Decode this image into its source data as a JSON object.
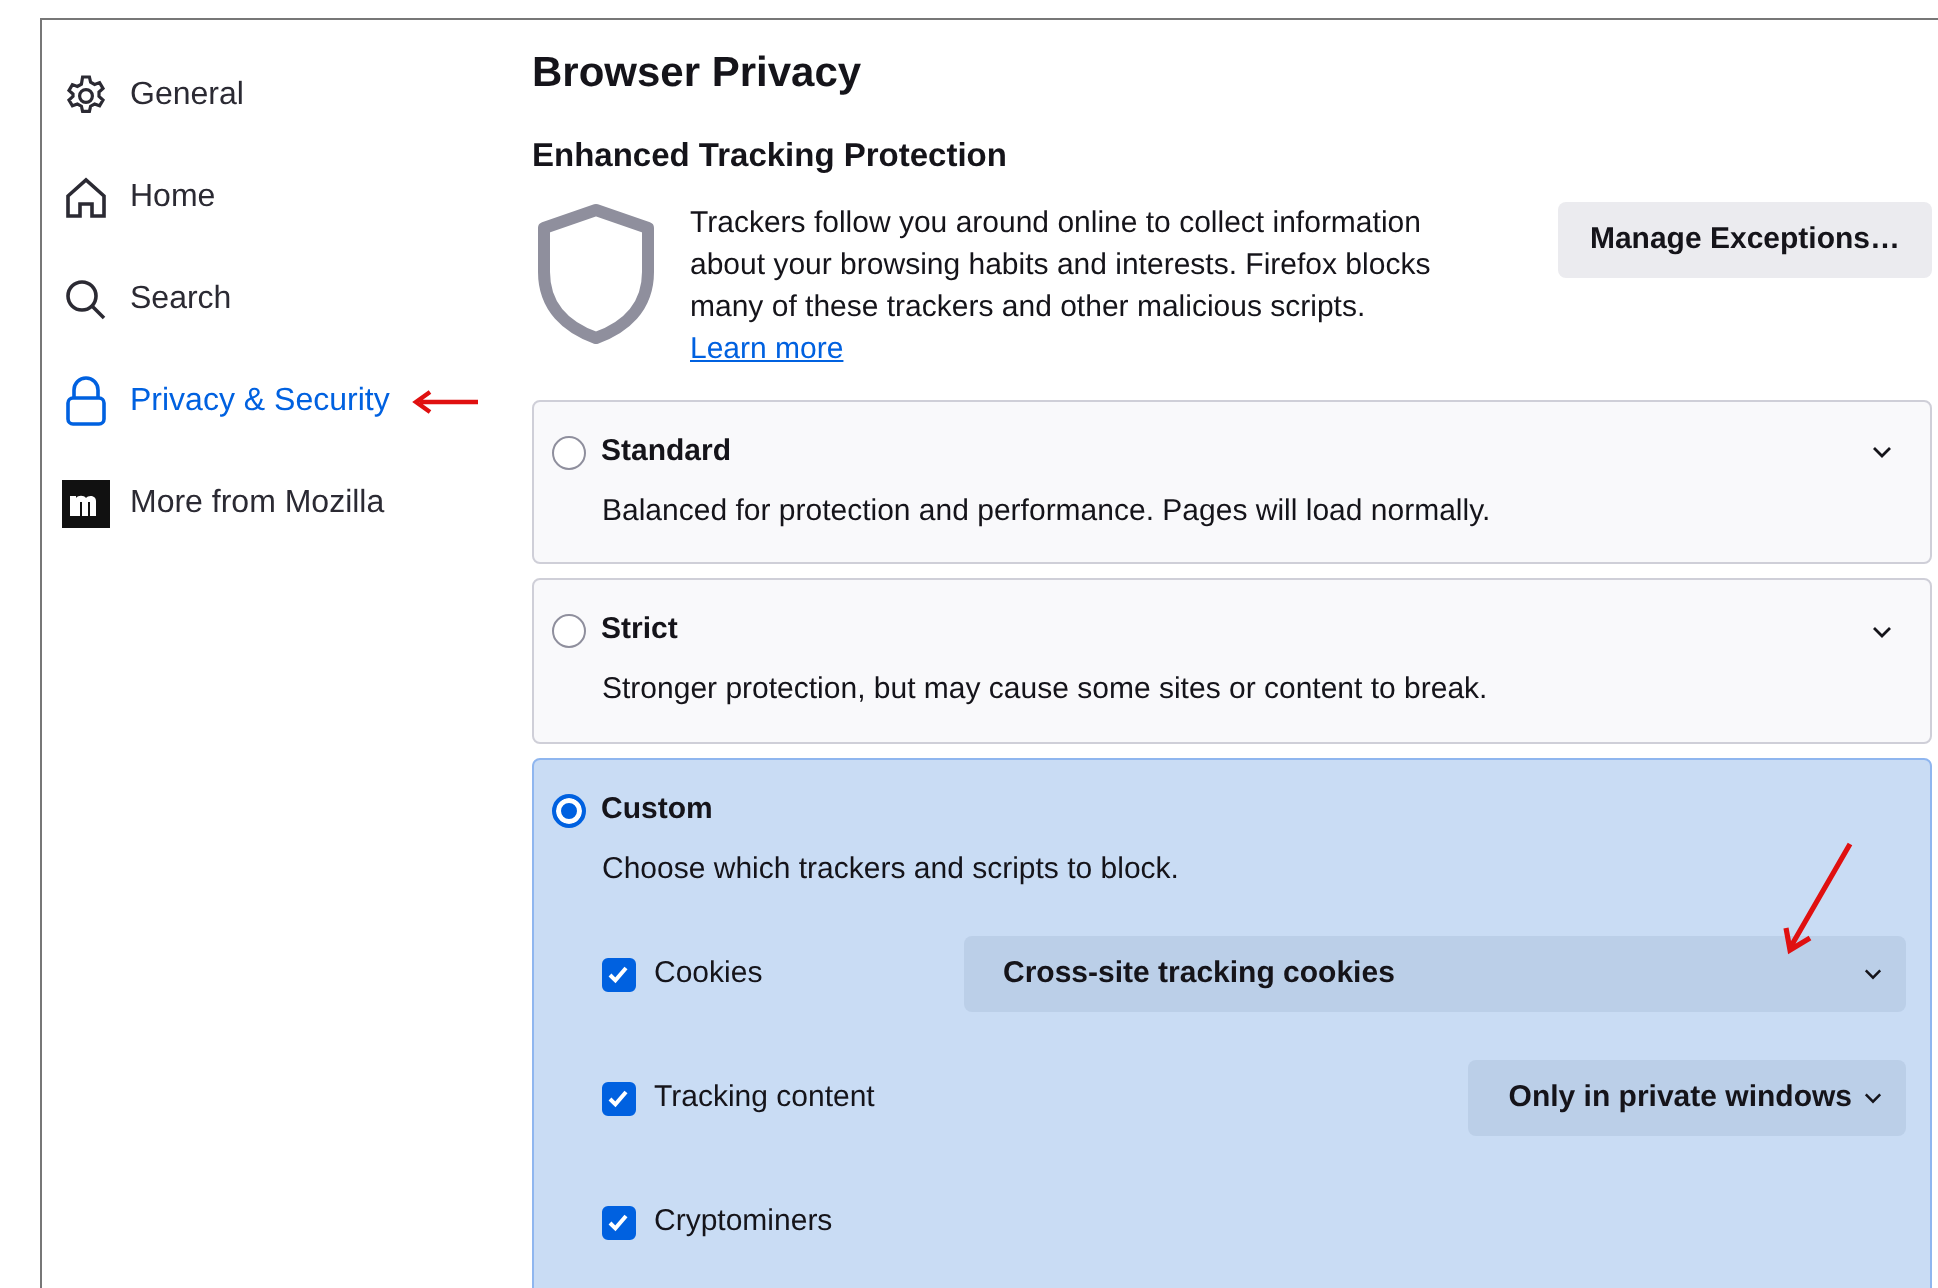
{
  "sidebar": {
    "items": [
      {
        "label": "General",
        "selected": false
      },
      {
        "label": "Home",
        "selected": false
      },
      {
        "label": "Search",
        "selected": false
      },
      {
        "label": "Privacy & Security",
        "selected": true
      },
      {
        "label": "More from Mozilla",
        "selected": false
      }
    ]
  },
  "page_title": "Browser Privacy",
  "section": {
    "heading": "Enhanced Tracking Protection",
    "description": "Trackers follow you around online to collect information about your browsing habits and interests. Firefox blocks many of these trackers and other malicious scripts.",
    "link": "Learn more",
    "button": "Manage Exceptions…"
  },
  "options": [
    {
      "label": "Standard",
      "description": "Balanced for protection and performance. Pages will load normally.",
      "selected": false
    },
    {
      "label": "Strict",
      "description": "Stronger protection, but may cause some sites or content to break.",
      "selected": false
    },
    {
      "label": "Custom",
      "description": "Choose which trackers and scripts to block.",
      "selected": true,
      "settings": [
        {
          "label": "Cookies",
          "checked": true,
          "dropdown": "Cross-site tracking cookies"
        },
        {
          "label": "Tracking content",
          "checked": true,
          "dropdown": "Only in private windows"
        },
        {
          "label": "Cryptominers",
          "checked": true
        }
      ]
    }
  ]
}
